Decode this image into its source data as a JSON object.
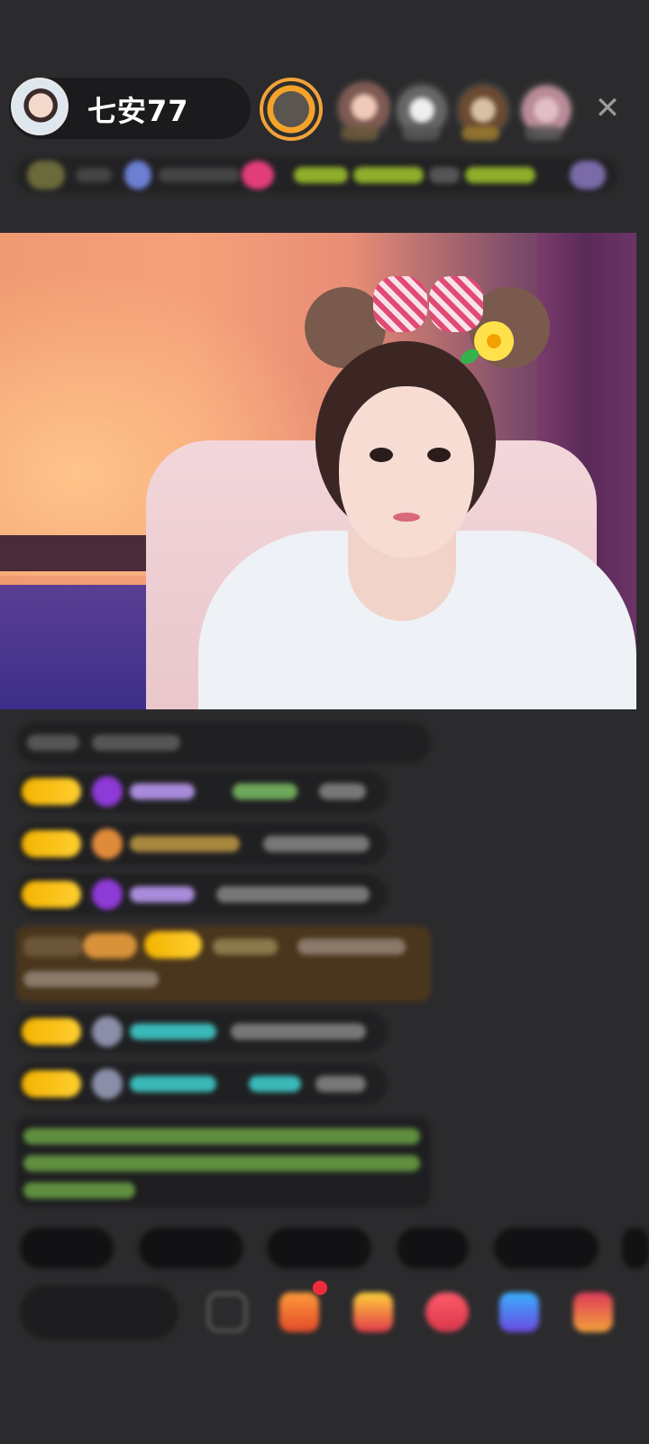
{
  "header": {
    "host_name": "七安77",
    "close_icon": "✕"
  },
  "colors": {
    "background": "#2b2b2d",
    "level_badge": "#f3b300",
    "username_purple": "#a98bdb",
    "username_orange": "#e0a25a",
    "username_teal": "#3bb8b8",
    "announcement_green": "#8bcf5a"
  },
  "icons": {
    "close": "close-icon",
    "emoji": "emoji-icon",
    "gift": "gift-icon",
    "toolbar": [
      "emoji-icon",
      "gift-icon",
      "gift-icon",
      "gift-icon",
      "gift-icon",
      "gift-icon"
    ]
  }
}
